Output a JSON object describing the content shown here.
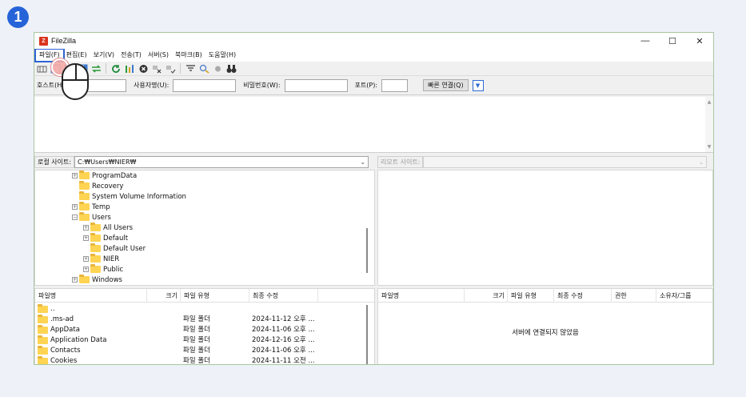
{
  "step": "1",
  "window": {
    "title": "FileZilla",
    "icon_letter": "Z",
    "controls": {
      "minimize": "—",
      "maximize": "☐",
      "close": "✕"
    }
  },
  "menu": [
    "파일(F)",
    "편집(E)",
    "보기(V)",
    "전송(T)",
    "서버(S)",
    "북마크(B)",
    "도움말(H)"
  ],
  "quickconnect": {
    "host_label": "호스트(H):",
    "host_value": "",
    "user_label": "사용자명(U):",
    "user_value": "",
    "password_label": "비밀번호(W):",
    "password_value": "",
    "port_label": "포트(P):",
    "port_value": "",
    "connect_button": "빠른 연결(Q)",
    "dropdown_icon": "▼"
  },
  "local": {
    "site_label": "로컬 사이트:",
    "path": "C:₩Users₩NIER₩",
    "tree": [
      {
        "label": "ProgramData",
        "expander": "+"
      },
      {
        "label": "Recovery",
        "expander": ""
      },
      {
        "label": "System Volume Information",
        "expander": ""
      },
      {
        "label": "Temp",
        "expander": "+"
      },
      {
        "label": "Users",
        "expander": "−"
      },
      {
        "label": "All Users",
        "expander": "+"
      },
      {
        "label": "Default",
        "expander": "+"
      },
      {
        "label": "Default User",
        "expander": ""
      },
      {
        "label": "NIER",
        "expander": "+"
      },
      {
        "label": "Public",
        "expander": "+"
      },
      {
        "label": "Windows",
        "expander": "+"
      }
    ],
    "columns": [
      "파일명",
      "크기",
      "파일 유형",
      "최종 수정"
    ],
    "files": [
      {
        "name": "..",
        "size": "",
        "type": "",
        "modified": ""
      },
      {
        "name": ".ms-ad",
        "size": "",
        "type": "파일 폴더",
        "modified": "2024-11-12 오후 ..."
      },
      {
        "name": "AppData",
        "size": "",
        "type": "파일 폴더",
        "modified": "2024-11-06 오후 ..."
      },
      {
        "name": "Application Data",
        "size": "",
        "type": "파일 폴더",
        "modified": "2024-12-16 오후 ..."
      },
      {
        "name": "Contacts",
        "size": "",
        "type": "파일 폴더",
        "modified": "2024-11-06 오후 ..."
      },
      {
        "name": "Cookies",
        "size": "",
        "type": "파일 폴더",
        "modified": "2024-11-11 오전 ..."
      }
    ]
  },
  "remote": {
    "site_label": "리모트 사이트:",
    "path": "",
    "columns": [
      "파일명",
      "크기",
      "파일 유형",
      "최종 수정",
      "권한",
      "소유자/그룹"
    ],
    "empty_message": "서버에 연결되지 않았음"
  },
  "colors": {
    "highlight": "#2f63d6",
    "step_badge": "#2663d8",
    "folder": "#ffd453"
  }
}
